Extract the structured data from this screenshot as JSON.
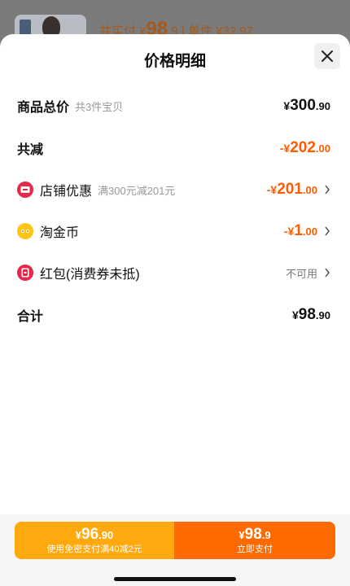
{
  "background": {
    "text_label": "共实付",
    "text_amount_int": "98",
    "text_amount_dec": ".9",
    "text_unit": "| 单件 ¥32.97"
  },
  "header": {
    "title": "价格明细"
  },
  "rows": {
    "total": {
      "label": "商品总价",
      "sub": "共3件宝贝",
      "cur": "¥",
      "int": "300",
      "dec": ".90"
    },
    "reduce": {
      "label": "共减",
      "cur": "-¥",
      "int": "202",
      "dec": ".00"
    },
    "store": {
      "label": "店铺优惠",
      "sub": "满300元减201元",
      "cur": "-¥",
      "int": "201",
      "dec": ".00"
    },
    "coin": {
      "label": "淘金币",
      "cur": "-¥",
      "int": "1",
      "dec": ".00"
    },
    "redpacket": {
      "label": "红包(消费券未抵)",
      "status": "不可用"
    },
    "sum": {
      "label": "合计",
      "cur": "¥",
      "int": "98",
      "dec": ".90"
    }
  },
  "footer": {
    "left_cur": "¥",
    "left_int": "96",
    "left_dec": ".90",
    "left_sub": "使用免密支付满40减2元",
    "right_cur": "¥",
    "right_int": "98",
    "right_dec": ".9",
    "right_sub": "立即支付"
  },
  "colors": {
    "accent": "#ff5b00",
    "pay_left": "#ffa90f",
    "pay_right": "#ff6a00"
  },
  "icons": [
    "close-icon",
    "store-coupon-icon",
    "coin-icon",
    "red-packet-icon",
    "chevron-right-icon"
  ]
}
